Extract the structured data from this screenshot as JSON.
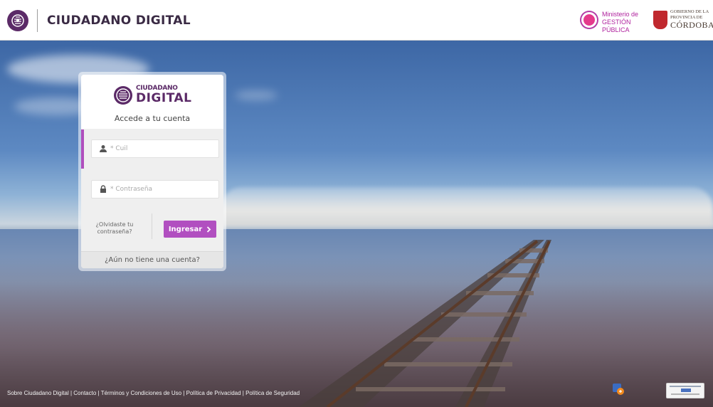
{
  "header": {
    "title": "CIUDADANO DIGITAL",
    "logo_icon": "ciudadano-digital-logo-icon",
    "ministry": {
      "line1": "Ministerio de",
      "line2": "GESTIÓN PÚBLICA"
    },
    "province": {
      "line1": "GOBIERNO DE LA",
      "line2": "PROVINCIA DE",
      "line3": "CÓRDOBA"
    }
  },
  "login": {
    "brand_small": "CIUDADANO",
    "brand_big": "DIGITAL",
    "subtitle": "Accede a tu cuenta",
    "cuil_placeholder": "* Cuil",
    "password_placeholder": "* Contraseña",
    "forgot_line1": "¿Olvidaste tu",
    "forgot_line2": "contraseña?",
    "submit_label": "Ingresar",
    "signup_label": "¿Aún no tiene una cuenta?"
  },
  "footer": {
    "links": [
      "Sobre Ciudadano Digital",
      "Contacto",
      "Términos y Condiciones de Uso",
      "Política de Privacidad",
      "Política de Seguridad"
    ],
    "separator": " | "
  },
  "colors": {
    "brand_purple": "#5b2a67",
    "accent_purple": "#b14fc0"
  }
}
